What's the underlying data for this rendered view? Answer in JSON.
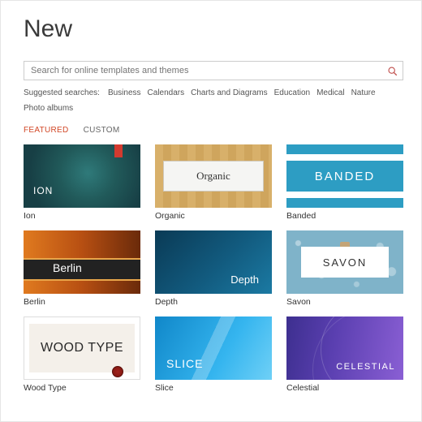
{
  "title": "New",
  "search": {
    "placeholder": "Search for online templates and themes"
  },
  "suggested": {
    "label": "Suggested searches:",
    "links": [
      "Business",
      "Calendars",
      "Charts and Diagrams",
      "Education",
      "Medical",
      "Nature",
      "Photo albums"
    ]
  },
  "tabs": [
    {
      "label": "FEATURED",
      "active": true
    },
    {
      "label": "CUSTOM",
      "active": false
    }
  ],
  "templates": [
    {
      "id": "ion",
      "caption": "Ion",
      "display": "ION"
    },
    {
      "id": "organic",
      "caption": "Organic",
      "display": "Organic"
    },
    {
      "id": "banded",
      "caption": "Banded",
      "display": "BANDED"
    },
    {
      "id": "berlin",
      "caption": "Berlin",
      "display": "Berlin"
    },
    {
      "id": "depth",
      "caption": "Depth",
      "display": "Depth"
    },
    {
      "id": "savon",
      "caption": "Savon",
      "display": "SAVON"
    },
    {
      "id": "woodtype",
      "caption": "Wood Type",
      "display": "WOOD TYPE"
    },
    {
      "id": "slice",
      "caption": "Slice",
      "display": "SLICE"
    },
    {
      "id": "celestial",
      "caption": "Celestial",
      "display": "CELESTIAL"
    }
  ],
  "colors": {
    "accent": "#d24726"
  }
}
